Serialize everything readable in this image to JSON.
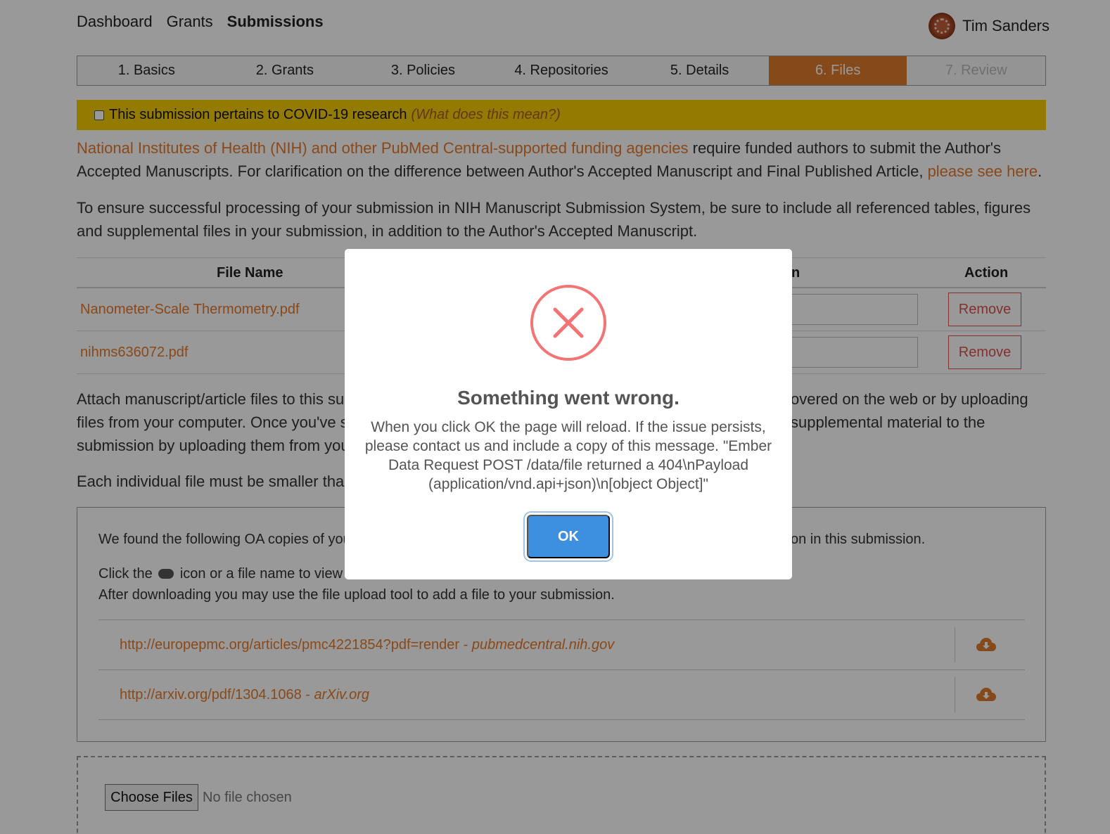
{
  "nav": {
    "items": [
      "Dashboard",
      "Grants",
      "Submissions"
    ],
    "user_name": "Tim Sanders"
  },
  "steps": [
    "1. Basics",
    "2. Grants",
    "3. Policies",
    "4. Repositories",
    "5. Details",
    "6. Files",
    "7. Review"
  ],
  "covid": {
    "label": "This submission pertains to COVID-19 research",
    "help_link": "(What does this mean?)"
  },
  "intro": {
    "link1": "National Institutes of Health (NIH) and other PubMed Central-supported funding agencies",
    "text1": " require funded authors to submit the Author's Accepted Manuscripts. For clarification on the difference between Author's Accepted Manuscript and Final Published Article, ",
    "link2": "please see here",
    "text2": ".",
    "para2": "To ensure successful processing of your submission in NIH Manuscript Submission System, be sure to include all referenced tables, figures and supplemental files in your submission, in addition to the Author's Accepted Manuscript."
  },
  "table": {
    "headers": {
      "file_name": "File Name",
      "description": "n",
      "action": "Action"
    },
    "rows": [
      {
        "name": "Nanometer-Scale Thermometry.pdf",
        "action": "Remove"
      },
      {
        "name": "nihms636072.pdf",
        "action": "Remove"
      }
    ]
  },
  "attach": {
    "line1_left": "Attach manuscript/article files to this sul",
    "line1_right": "overed on the web or by uploading",
    "line2_left": "files from your computer. Once you've se",
    "line2_right": "supplemental material to the",
    "line3_left": "submission by uploading them from you",
    "size_left": "Each individual file must be smaller than"
  },
  "oa": {
    "found_left": "We found the following OA copies of you",
    "found_right": "on in this submission.",
    "click_left": "Click the",
    "click_right": "icon or a file name to view a",
    "after": "After downloading you may use the file upload tool to add a file to your submission.",
    "links": [
      {
        "url": "http://europepmc.org/articles/pmc4221854?pdf=render",
        "source": "pubmedcentral.nih.gov",
        "icon": "cloud-download-icon"
      },
      {
        "url": "http://arxiv.org/pdf/1304.1068",
        "source": "arXiv.org",
        "icon": "cloud-download-icon"
      }
    ]
  },
  "upload": {
    "button": "Choose Files",
    "status": "No file chosen"
  },
  "modal": {
    "icon": "error-x-icon",
    "title": "Something went wrong.",
    "message": "When you click OK the page will reload. If the issue persists, please contact us and include a copy of this message. \"Ember Data Request POST /data/file returned a 404\\nPayload (application/vnd.api+json)\\n[object Object]\"",
    "ok": "OK"
  },
  "colors": {
    "accent": "#e07b2a",
    "covid_banner": "#f6cc00",
    "error": "#f27474",
    "ok_button": "#3d8fe0"
  }
}
